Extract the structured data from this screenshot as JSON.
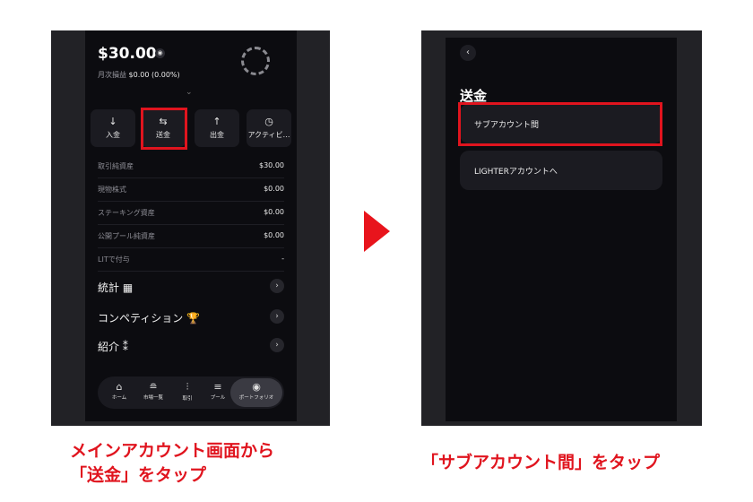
{
  "left": {
    "balance": "$30.00",
    "pnl_label": "月次損益",
    "pnl_value": "$0.00 (0.00%)",
    "actions": [
      {
        "label": "入金",
        "icon": "↓"
      },
      {
        "label": "送金",
        "icon": "⇆"
      },
      {
        "label": "出金",
        "icon": "↑"
      },
      {
        "label": "アクティビ…",
        "icon": "◷"
      }
    ],
    "rows": [
      {
        "key": "取引純資産",
        "value": "$30.00"
      },
      {
        "key": "現物株式",
        "value": "$0.00"
      },
      {
        "key": "ステーキング資産",
        "value": "$0.00"
      },
      {
        "key": "公開プール純資産",
        "value": "$0.00"
      },
      {
        "key": "LITで付与",
        "value": "-"
      }
    ],
    "sections": [
      {
        "label": "統計 ▦"
      },
      {
        "label": "コンペティション 🏆"
      },
      {
        "label": "紹介 ⁑"
      }
    ],
    "nav": [
      {
        "label": "ホーム",
        "icon": "⌂"
      },
      {
        "label": "市場一覧",
        "icon": "≘"
      },
      {
        "label": "取引",
        "icon": "⫶"
      },
      {
        "label": "プール",
        "icon": "≡"
      },
      {
        "label": "ポートフォリオ",
        "icon": "◉"
      }
    ]
  },
  "right": {
    "back_icon": "‹",
    "title": "送金",
    "options": [
      {
        "label": "サブアカウント間"
      },
      {
        "label": "LIGHTERアカウントへ"
      }
    ]
  },
  "captions": {
    "left_line1": "メインアカウント画面から",
    "left_line2": "「送金」をタップ",
    "right": "「サブアカウント間」をタップ"
  },
  "colors": {
    "highlight": "#e0141e",
    "background": "#0c0c10"
  }
}
